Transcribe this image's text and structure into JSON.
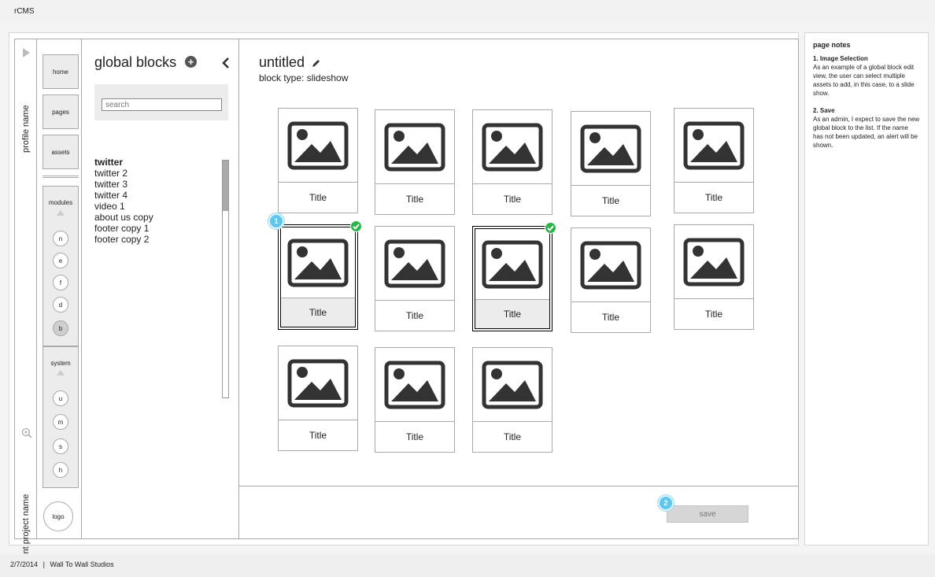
{
  "app": {
    "title": "rCMS"
  },
  "footer": {
    "date": "2/7/2014",
    "separator": "|",
    "studio": "Wall To Wall Studios"
  },
  "rail": {
    "profile_name": "profile name",
    "client_project_name": "client project name"
  },
  "nav": {
    "buttons": [
      "home",
      "pages",
      "assets"
    ],
    "modules_label": "modules",
    "modules": [
      "n",
      "e",
      "f",
      "d",
      "b"
    ],
    "system_label": "system",
    "system": [
      "u",
      "m",
      "s",
      "h"
    ],
    "logo_label": "logo"
  },
  "panel": {
    "title": "global blocks",
    "search_placeholder": "search",
    "items": [
      "twitter",
      "twitter 2",
      "twitter 3",
      "twitter 4",
      "video 1",
      "about us copy",
      "footer copy 1",
      "footer copy 2"
    ]
  },
  "main": {
    "title": "untitled",
    "block_type": "block type: slideshow",
    "cards": [
      {
        "title": "Title",
        "selected": false
      },
      {
        "title": "Title",
        "selected": false
      },
      {
        "title": "Title",
        "selected": false
      },
      {
        "title": "Title",
        "selected": false
      },
      {
        "title": "Title",
        "selected": false
      },
      {
        "title": "Title",
        "selected": true
      },
      {
        "title": "Title",
        "selected": false
      },
      {
        "title": "Title",
        "selected": true
      },
      {
        "title": "Title",
        "selected": false
      },
      {
        "title": "Title",
        "selected": false
      },
      {
        "title": "Title",
        "selected": false
      },
      {
        "title": "Title",
        "selected": false
      },
      {
        "title": "Title",
        "selected": false
      }
    ],
    "badge_1": "1",
    "badge_2": "2",
    "save_label": "save"
  },
  "notes": {
    "heading": "page notes",
    "items": [
      {
        "title": "1. Image Selection",
        "body": "As an example of a global block edit view, the user can select multiple assets to add, in this case, to a slide show."
      },
      {
        "title": "2. Save",
        "body": "As an admin, I expect to save the new global block to the list. If the name has not been updated, an alert will be shown."
      }
    ]
  },
  "colors": {
    "badge": "#5fc6ee",
    "check": "#2bb34a",
    "icon": "#333333"
  }
}
